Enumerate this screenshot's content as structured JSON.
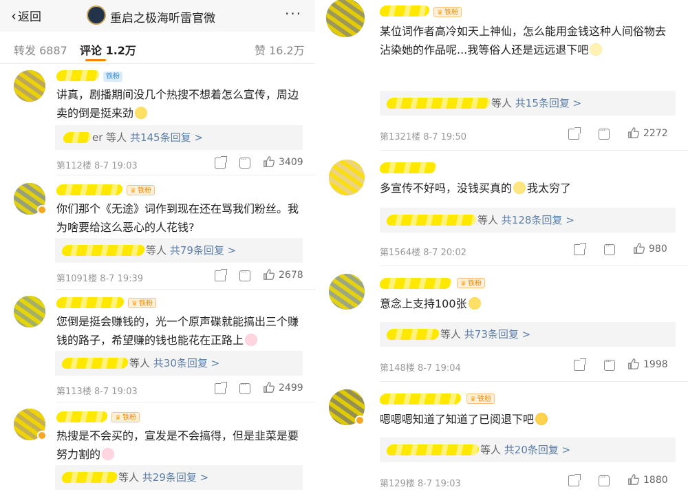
{
  "header": {
    "back_label": "返回",
    "account_name": "重启之极海听雷官微"
  },
  "stats": {
    "reposts": "转发 6887",
    "comments": "评论 1.2万",
    "likes": "赞 16.2万"
  },
  "left_comments": [
    {
      "badge": "铁粉",
      "text": "讲真，剧播期间没几个热搜不想着怎么宣传，周边卖的倒是挺来劲",
      "emoji": "laugh-emoji",
      "reply_suffix": "er 等人",
      "reply_count": "共145条回复 >",
      "floor_time": "第112楼  8-7 19:03",
      "likes": "3409"
    },
    {
      "badge": "铁粉",
      "text": "你们那个《无途》词作到现在还在骂我们粉丝。我为啥要给这么恶心的人花钱?",
      "emoji": "",
      "reply_suffix": "等人",
      "reply_count": "共79条回复 >",
      "floor_time": "第1091楼  8-7 19:39",
      "likes": "2678"
    },
    {
      "badge": "铁粉",
      "text": "您倒是挺会赚钱的，光一个原声碟就能搞出三个赚钱的路子，希望赚的钱也能花在正路上",
      "emoji": "pig-emoji",
      "reply_suffix": "等人",
      "reply_count": "共30条回复 >",
      "floor_time": "第113楼  8-7 19:03",
      "likes": "2499"
    },
    {
      "badge": "铁粉",
      "text": "热搜是不会买的，宣发是不会搞得，但是韭菜是要努力割的",
      "emoji": "pig-emoji",
      "reply_suffix": "等人",
      "reply_count": "共29条回复 >",
      "floor_time": "",
      "likes": ""
    }
  ],
  "right_comments": [
    {
      "badge": "铁粉",
      "text": "某位词作者高冷如天上神仙，怎么能用金钱这种人间俗物去沾染她的作品呢...我等俗人还是远远退下吧",
      "emoji": "sad-emoji",
      "reply_suffix": "等人",
      "reply_count": "共15条回复 >",
      "floor_time": "第1321楼  8-7 19:50",
      "likes": "2272"
    },
    {
      "badge": "",
      "text": "多宣传不好吗，没钱买真的",
      "text2": "我太穷了",
      "emoji": "smile-emoji",
      "reply_suffix": "等人",
      "reply_count": "共128条回复 >",
      "floor_time": "第1564楼  8-7 20:02",
      "likes": "980"
    },
    {
      "badge": "铁粉",
      "text": "意念上支持100张",
      "emoji": "shock-emoji",
      "reply_suffix": "等人",
      "reply_count": "共73条回复 >",
      "floor_time": "第148楼  8-7 19:04",
      "likes": "1998"
    },
    {
      "badge": "铁粉",
      "text": "嗯嗯嗯知道了知道了已阅退下吧",
      "emoji": "yum-emoji",
      "reply_suffix": "等人",
      "reply_count": "共20条回复 >",
      "floor_time": "第129楼  8-7 19:03",
      "likes": "1880"
    }
  ],
  "colors": {
    "accent": "#ff8200",
    "reply_link": "#5b7ea8",
    "mask_yellow": "#ffe800"
  }
}
